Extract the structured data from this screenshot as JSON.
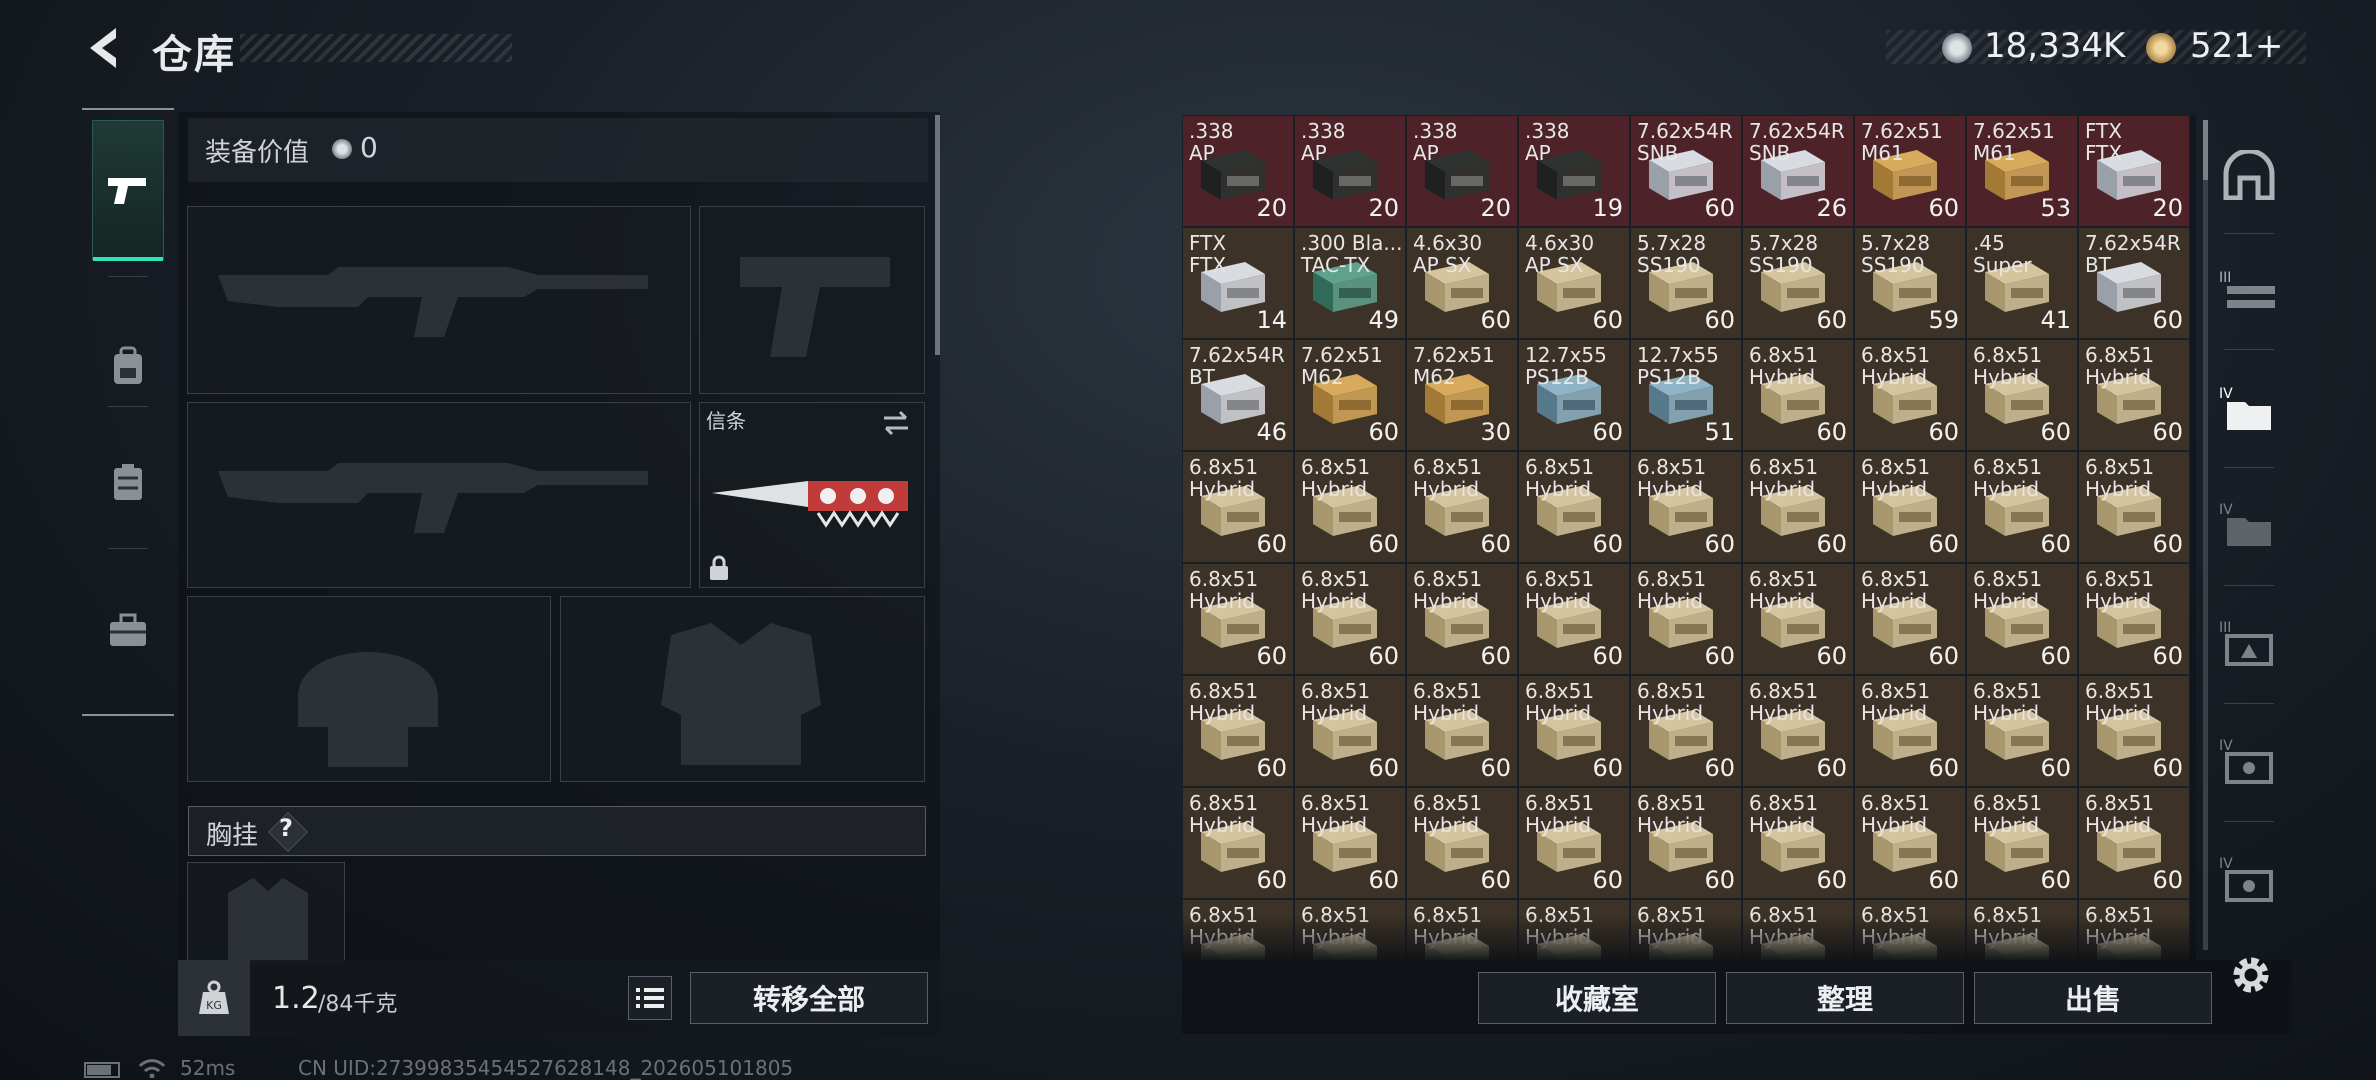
{
  "header": {
    "title": "仓库"
  },
  "currency": {
    "coin_amount": "18,334K",
    "ticket_amount": "521+"
  },
  "equipment": {
    "value_label": "装备价值",
    "value": "0",
    "melee_label": "信条",
    "chest_label": "胸挂",
    "chest_help": "?",
    "weight": "1.2",
    "weight_max": "/84千克",
    "transfer_label": "转移全部"
  },
  "inventory": {
    "buttons": {
      "vault": "收藏室",
      "sort": "整理",
      "sell": "出售"
    },
    "items": [
      {
        "n1": ".338",
        "n2": "AP",
        "q": "20",
        "bg": "red",
        "box": "dark"
      },
      {
        "n1": ".338",
        "n2": "AP",
        "q": "20",
        "bg": "red",
        "box": "dark"
      },
      {
        "n1": ".338",
        "n2": "AP",
        "q": "20",
        "bg": "red",
        "box": "dark"
      },
      {
        "n1": ".338",
        "n2": "AP",
        "q": "19",
        "bg": "red",
        "box": "dark"
      },
      {
        "n1": "7.62x54R",
        "n2": "SNB",
        "q": "60",
        "bg": "red",
        "box": "white"
      },
      {
        "n1": "7.62x54R",
        "n2": "SNB",
        "q": "26",
        "bg": "red",
        "box": "white"
      },
      {
        "n1": "7.62x51",
        "n2": "M61",
        "q": "60",
        "bg": "red",
        "box": "gold"
      },
      {
        "n1": "7.62x51",
        "n2": "M61",
        "q": "53",
        "bg": "red",
        "box": "gold"
      },
      {
        "n1": "FTX",
        "n2": "FTX",
        "q": "20",
        "bg": "red",
        "box": "white"
      },
      {
        "n1": "FTX",
        "n2": "FTX",
        "q": "14",
        "bg": "brown",
        "box": "white"
      },
      {
        "n1": ".300 Bla...",
        "n2": "TAC-TX",
        "q": "49",
        "bg": "brown",
        "box": "green"
      },
      {
        "n1": "4.6x30",
        "n2": "AP SX",
        "q": "60",
        "bg": "brown",
        "box": "tan"
      },
      {
        "n1": "4.6x30",
        "n2": "AP SX",
        "q": "60",
        "bg": "brown",
        "box": "tan"
      },
      {
        "n1": "5.7x28",
        "n2": "SS190",
        "q": "60",
        "bg": "brown",
        "box": "tan"
      },
      {
        "n1": "5.7x28",
        "n2": "SS190",
        "q": "60",
        "bg": "brown",
        "box": "tan"
      },
      {
        "n1": "5.7x28",
        "n2": "SS190",
        "q": "59",
        "bg": "brown",
        "box": "tan"
      },
      {
        "n1": ".45",
        "n2": "Super",
        "q": "41",
        "bg": "brown",
        "box": "tan"
      },
      {
        "n1": "7.62x54R",
        "n2": "BT",
        "q": "60",
        "bg": "brown",
        "box": "white"
      },
      {
        "n1": "7.62x54R",
        "n2": "BT",
        "q": "46",
        "bg": "brown",
        "box": "white"
      },
      {
        "n1": "7.62x51",
        "n2": "M62",
        "q": "60",
        "bg": "brown",
        "box": "gold"
      },
      {
        "n1": "7.62x51",
        "n2": "M62",
        "q": "30",
        "bg": "brown",
        "box": "gold"
      },
      {
        "n1": "12.7x55",
        "n2": "PS12B",
        "q": "60",
        "bg": "brown",
        "box": "blue"
      },
      {
        "n1": "12.7x55",
        "n2": "PS12B",
        "q": "51",
        "bg": "brown",
        "box": "blue"
      },
      {
        "n1": "6.8x51",
        "n2": "Hybrid",
        "q": "60",
        "bg": "brown",
        "box": "tan"
      },
      {
        "n1": "6.8x51",
        "n2": "Hybrid",
        "q": "60",
        "bg": "brown",
        "box": "tan"
      },
      {
        "n1": "6.8x51",
        "n2": "Hybrid",
        "q": "60",
        "bg": "brown",
        "box": "tan"
      },
      {
        "n1": "6.8x51",
        "n2": "Hybrid",
        "q": "60",
        "bg": "brown",
        "box": "tan"
      },
      {
        "n1": "6.8x51",
        "n2": "Hybrid",
        "q": "60",
        "bg": "brown",
        "box": "tan"
      },
      {
        "n1": "6.8x51",
        "n2": "Hybrid",
        "q": "60",
        "bg": "brown",
        "box": "tan"
      },
      {
        "n1": "6.8x51",
        "n2": "Hybrid",
        "q": "60",
        "bg": "brown",
        "box": "tan"
      },
      {
        "n1": "6.8x51",
        "n2": "Hybrid",
        "q": "60",
        "bg": "brown",
        "box": "tan"
      },
      {
        "n1": "6.8x51",
        "n2": "Hybrid",
        "q": "60",
        "bg": "brown",
        "box": "tan"
      },
      {
        "n1": "6.8x51",
        "n2": "Hybrid",
        "q": "60",
        "bg": "brown",
        "box": "tan"
      },
      {
        "n1": "6.8x51",
        "n2": "Hybrid",
        "q": "60",
        "bg": "brown",
        "box": "tan"
      },
      {
        "n1": "6.8x51",
        "n2": "Hybrid",
        "q": "60",
        "bg": "brown",
        "box": "tan"
      },
      {
        "n1": "6.8x51",
        "n2": "Hybrid",
        "q": "60",
        "bg": "brown",
        "box": "tan"
      },
      {
        "n1": "6.8x51",
        "n2": "Hybrid",
        "q": "60",
        "bg": "brown",
        "box": "tan"
      },
      {
        "n1": "6.8x51",
        "n2": "Hybrid",
        "q": "60",
        "bg": "brown",
        "box": "tan"
      },
      {
        "n1": "6.8x51",
        "n2": "Hybrid",
        "q": "60",
        "bg": "brown",
        "box": "tan"
      },
      {
        "n1": "6.8x51",
        "n2": "Hybrid",
        "q": "60",
        "bg": "brown",
        "box": "tan"
      },
      {
        "n1": "6.8x51",
        "n2": "Hybrid",
        "q": "60",
        "bg": "brown",
        "box": "tan"
      },
      {
        "n1": "6.8x51",
        "n2": "Hybrid",
        "q": "60",
        "bg": "brown",
        "box": "tan"
      },
      {
        "n1": "6.8x51",
        "n2": "Hybrid",
        "q": "60",
        "bg": "brown",
        "box": "tan"
      },
      {
        "n1": "6.8x51",
        "n2": "Hybrid",
        "q": "60",
        "bg": "brown",
        "box": "tan"
      },
      {
        "n1": "6.8x51",
        "n2": "Hybrid",
        "q": "60",
        "bg": "brown",
        "box": "tan"
      },
      {
        "n1": "6.8x51",
        "n2": "Hybrid",
        "q": "60",
        "bg": "brown",
        "box": "tan"
      },
      {
        "n1": "6.8x51",
        "n2": "Hybrid",
        "q": "60",
        "bg": "brown",
        "box": "tan"
      },
      {
        "n1": "6.8x51",
        "n2": "Hybrid",
        "q": "60",
        "bg": "brown",
        "box": "tan"
      },
      {
        "n1": "6.8x51",
        "n2": "Hybrid",
        "q": "60",
        "bg": "brown",
        "box": "tan"
      },
      {
        "n1": "6.8x51",
        "n2": "Hybrid",
        "q": "60",
        "bg": "brown",
        "box": "tan"
      },
      {
        "n1": "6.8x51",
        "n2": "Hybrid",
        "q": "60",
        "bg": "brown",
        "box": "tan"
      },
      {
        "n1": "6.8x51",
        "n2": "Hybrid",
        "q": "60",
        "bg": "brown",
        "box": "tan"
      },
      {
        "n1": "6.8x51",
        "n2": "Hybrid",
        "q": "60",
        "bg": "brown",
        "box": "tan"
      },
      {
        "n1": "6.8x51",
        "n2": "Hybrid",
        "q": "60",
        "bg": "brown",
        "box": "tan"
      },
      {
        "n1": "6.8x51",
        "n2": "Hybrid",
        "q": "60",
        "bg": "brown",
        "box": "tan"
      },
      {
        "n1": "6.8x51",
        "n2": "Hybrid",
        "q": "60",
        "bg": "brown",
        "box": "tan"
      },
      {
        "n1": "6.8x51",
        "n2": "Hybrid",
        "q": "60",
        "bg": "brown",
        "box": "tan"
      },
      {
        "n1": "6.8x51",
        "n2": "Hybrid",
        "q": "60",
        "bg": "brown",
        "box": "tan"
      },
      {
        "n1": "6.8x51",
        "n2": "Hybrid",
        "q": "60",
        "bg": "brown",
        "box": "tan"
      },
      {
        "n1": "6.8x51",
        "n2": "Hybrid",
        "q": "60",
        "bg": "brown",
        "box": "tan"
      },
      {
        "n1": "6.8x51",
        "n2": "Hybrid",
        "q": "60",
        "bg": "brown",
        "box": "tan"
      },
      {
        "n1": "6.8x51",
        "n2": "Hybrid",
        "q": "60",
        "bg": "brown",
        "box": "tan"
      },
      {
        "n1": "6.8x51",
        "n2": "Hybrid",
        "q": "60",
        "bg": "brown",
        "box": "tan"
      },
      {
        "n1": "6.8x51",
        "n2": "Hybrid",
        "q": "",
        "bg": "brown",
        "box": "tan"
      },
      {
        "n1": "6.8x51",
        "n2": "Hybrid",
        "q": "",
        "bg": "brown",
        "box": "tan"
      },
      {
        "n1": "6.8x51",
        "n2": "Hybrid",
        "q": "",
        "bg": "brown",
        "box": "tan"
      },
      {
        "n1": "6.8x51",
        "n2": "Hybrid",
        "q": "",
        "bg": "brown",
        "box": "tan"
      },
      {
        "n1": "6.8x51",
        "n2": "Hybrid",
        "q": "",
        "bg": "brown",
        "box": "tan"
      },
      {
        "n1": "6.8x51",
        "n2": "Hybrid",
        "q": "",
        "bg": "brown",
        "box": "tan"
      },
      {
        "n1": "6.8x51",
        "n2": "Hybrid",
        "q": "",
        "bg": "brown",
        "box": "tan"
      },
      {
        "n1": "6.8x51",
        "n2": "Hybrid",
        "q": "",
        "bg": "brown",
        "box": "tan"
      },
      {
        "n1": "6.8x51",
        "n2": "Hybrid",
        "q": "",
        "bg": "brown",
        "box": "tan"
      }
    ]
  },
  "right_nav": {
    "tiers": [
      "III",
      "IV",
      "IV",
      "III",
      "IV",
      "IV"
    ]
  },
  "status": {
    "ping": "52ms",
    "uid": "CN UID:27399835454527628148_202605101805"
  },
  "colors": {
    "accent": "#2ee6b7",
    "red_slot": "#4d2329",
    "brown_slot": "#3d3227"
  }
}
